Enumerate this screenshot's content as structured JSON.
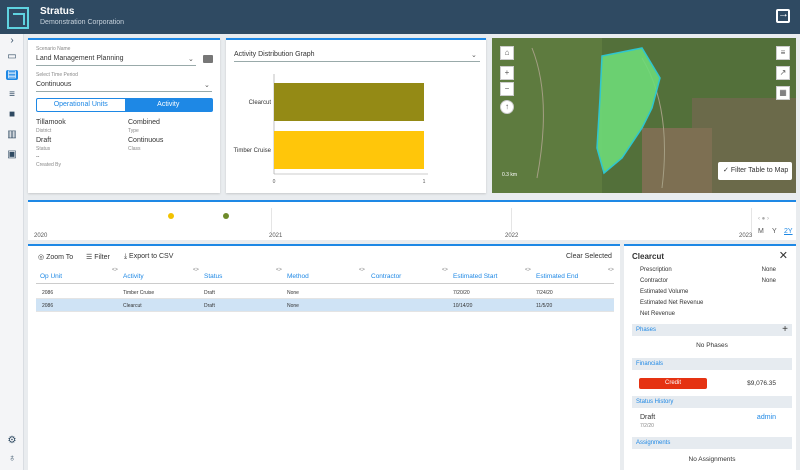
{
  "header": {
    "title": "Stratus",
    "subtitle": "Demonstration Corporation"
  },
  "scenario": {
    "name_label": "Scenario Name",
    "name_value": "Land Management Planning",
    "period_label": "Select Time Period",
    "period_value": "Continuous",
    "tabs": [
      "Operational Units",
      "Activity"
    ],
    "info": [
      {
        "value": "Tillamook",
        "label": "District"
      },
      {
        "value": "Combined",
        "label": "Type"
      },
      {
        "value": "Draft",
        "label": "Status"
      },
      {
        "value": "Continuous",
        "label": "Class"
      },
      {
        "value": "--",
        "label": "Created By"
      }
    ]
  },
  "graph": {
    "title": "Activity Distribution Graph"
  },
  "chart_data": {
    "type": "bar",
    "categories": [
      "Clearcut",
      "Timber Cruise"
    ],
    "values": [
      1,
      1
    ],
    "xlim": [
      0,
      1
    ],
    "ticks": [
      "0",
      "1"
    ],
    "colors": [
      "#948a15",
      "#ffc60a"
    ]
  },
  "map": {
    "filter_label": "Filter Table to Map",
    "scale": "0.3 km"
  },
  "timeline": {
    "years": [
      "2020",
      "2021",
      "2022",
      "2023"
    ],
    "controls": [
      "M",
      "Y",
      "2Y"
    ],
    "dots": [
      {
        "color": "#f2c200"
      },
      {
        "color": "#6e8b2a"
      }
    ]
  },
  "table": {
    "toolbar": {
      "zoom": "Zoom To",
      "filter": "Filter",
      "export": "Export to CSV",
      "clear": "Clear Selected"
    },
    "columns": [
      "Op Unit",
      "Activity",
      "Status",
      "Method",
      "Contractor",
      "Estimated Start",
      "Estimated End"
    ],
    "rows": [
      [
        "2086",
        "Timber Cruise",
        "Draft",
        "None",
        "",
        "7/20/20",
        "7/24/20"
      ],
      [
        "2086",
        "Clearcut",
        "Draft",
        "None",
        "",
        "10/14/20",
        "11/5/20"
      ]
    ]
  },
  "detail": {
    "title": "Clearcut",
    "fields": [
      {
        "k": "Prescription",
        "v": "None"
      },
      {
        "k": "Contractor",
        "v": "None"
      },
      {
        "k": "Estimated Volume",
        "v": ""
      },
      {
        "k": "Estimated Net Revenue",
        "v": ""
      },
      {
        "k": "Net Revenue",
        "v": ""
      }
    ],
    "phases": "Phases",
    "no_phases": "No Phases",
    "financials": "Financials",
    "credit": "Credit",
    "credit_amount": "$9,076.35",
    "status_history": "Status History",
    "hist_status": "Draft",
    "hist_date": "7/2/20",
    "hist_user": "admin",
    "assignments": "Assignments",
    "no_assignments": "No Assignments"
  },
  "colors": {
    "accent": "#1e88e5",
    "header": "#2f4a62",
    "credit": "#e53212"
  }
}
